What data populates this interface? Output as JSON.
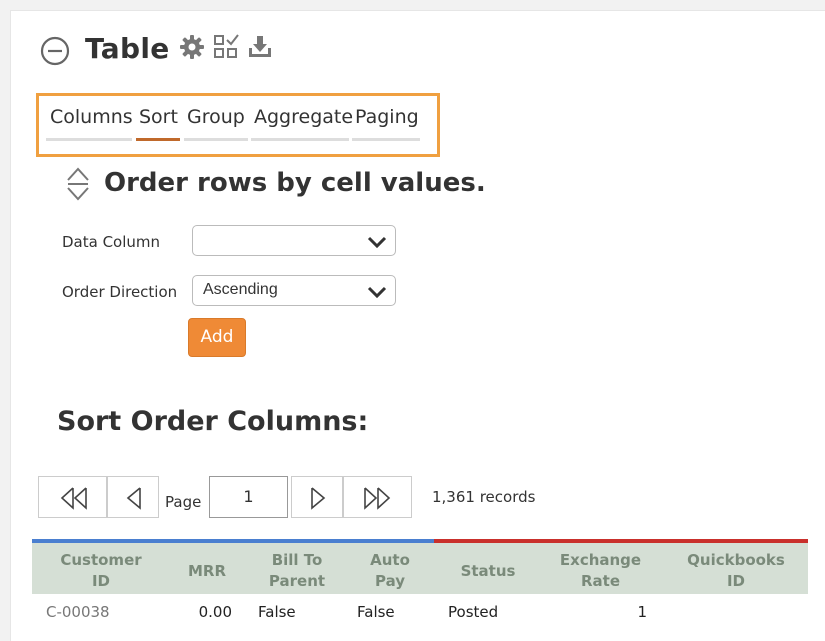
{
  "header": {
    "title": "Table",
    "icons": [
      "minus-circle-icon",
      "gear-icon",
      "checklist-icon",
      "download-icon"
    ]
  },
  "tabs": [
    {
      "label": "Columns",
      "active": false
    },
    {
      "label": "Sort",
      "active": true
    },
    {
      "label": "Group",
      "active": false
    },
    {
      "label": "Aggregate",
      "active": false
    },
    {
      "label": "Paging",
      "active": false
    }
  ],
  "sort_section": {
    "title": "Order rows by cell values.",
    "data_column_label": "Data Column",
    "data_column_value": "",
    "order_direction_label": "Order Direction",
    "order_direction_value": "Ascending",
    "add_button": "Add",
    "sort_order_title": "Sort Order Columns:"
  },
  "pager": {
    "page_label": "Page",
    "page_value": "1",
    "records_text": "1,361 records"
  },
  "grid": {
    "columns": [
      "Customer ID",
      "MRR",
      "Bill To Parent",
      "Auto Pay",
      "Status",
      "Exchange Rate",
      "Quickbooks ID"
    ],
    "rows": [
      [
        "C-00038",
        "0.00",
        "False",
        "False",
        "Posted",
        "1",
        ""
      ]
    ]
  },
  "colors": {
    "accent": "#ef8a36",
    "tab_active": "#c0692b",
    "highlight_box": "#f0a040",
    "grid_header_bg": "#d5dfd5",
    "grid_bar_blue": "#4a7fd0",
    "grid_bar_red": "#c9302c"
  }
}
